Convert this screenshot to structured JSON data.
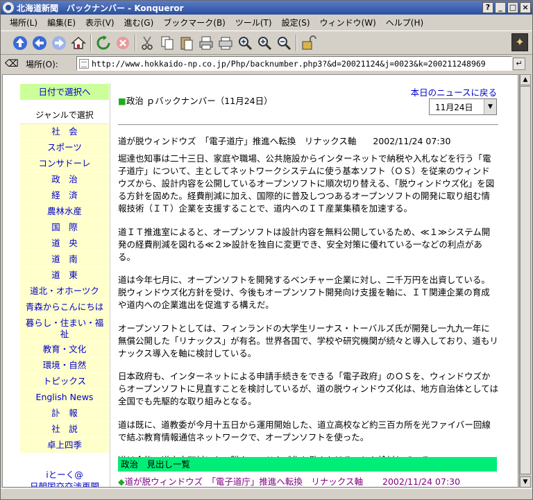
{
  "window": {
    "title": "北海道新聞　バックナンバー - Konqueror",
    "buttons": [
      "?",
      "_",
      "□",
      "×"
    ]
  },
  "menubar": {
    "items": [
      "場所(L)",
      "編集(E)",
      "表示(V)",
      "進む(G)",
      "ブックマーク(B)",
      "ツール(T)",
      "設定(S)",
      "ウィンドウ(W)",
      "ヘルプ(H)"
    ]
  },
  "toolbar": {
    "icons": [
      "up-icon",
      "back-icon",
      "forward-icon",
      "home-icon",
      "reload-icon",
      "stop-icon",
      "cut-icon",
      "copy-icon",
      "paste-icon",
      "print-icon",
      "print-frame-icon",
      "zoom-in-icon",
      "zoom-icon",
      "zoom-out-icon",
      "security-icon"
    ]
  },
  "location": {
    "label": "場所(O):",
    "url": "http://www.hokkaido-np.co.jp/Php/backnumber.php3?&d=20021124&j=0023&k=200211248969"
  },
  "nav": {
    "date_select": "日付で選択へ",
    "genre_label": "ジャンルで選択",
    "items": [
      "社　会",
      "スポーツ",
      "コンサドーレ",
      "政　治",
      "経　済",
      "農林水産",
      "国　際",
      "道　央",
      "道　南",
      "道　東",
      "道北・オホーツク",
      "青森からこんにちは",
      "暮らし・住まい・福祉",
      "教育・文化",
      "環境・自然",
      "トピックス",
      "English News",
      "訃　報",
      "社　説",
      "卓上四季"
    ],
    "bottom": [
      "iとーく@",
      "日朝国交交渉再開"
    ]
  },
  "main": {
    "crumb_prefix": "■",
    "crumb": "政治 ｐバックナンバー（11月24日）",
    "back_link": "本日のニュースに戻る",
    "date_value": "11月24日",
    "headline": "道が脱ウィンドウズ　「電子道庁」推進へ転換　リナックス軸",
    "headline_date": "2002/11/24 07:30",
    "paragraphs": [
      "堀達也知事は二十三日、家庭や職場、公共施設からインターネットで納税や入札などを行う「電子道庁」について、主としてネットワークシステムに使う基本ソフト（ＯＳ）を従来のウィンドウズから、設計内容を公開しているオープンソフトに順次切り替える、「脱ウィンドウズ化」を図る方針を固めた。経費削減に加え、国際的に普及しつつあるオープンソフトの開発に取り組む情報技術（ＩＴ）企業を支援することで、道内へのＩＴ産業集積を加速する。",
      "道ＩＴ推進室によると、オープンソフトは設計内容を無料公開しているため、≪１≫システム開発の経費削減を図れる≪２≫設計を独自に変更でき、安全対策に優れている一などの利点がある。",
      "道は今年七月に、オープンソフトを開発するベンチャー企業に対し、二千万円を出資している。脱ウィンドウズ化方針を受け、今後もオープンソフト開発向け支援を軸に、ＩＴ関連企業の育成や道内への企業進出を促進する構えだ。",
      "オープンソフトとしては、フィンランドの大学生リーナス・トーバルズ氏が開発し一九九一年に無償公開した「リナックス」が有名。世界各国で、学校や研究機関が続々と導入しており、道もリナックス導入を軸に検討している。",
      "日本政府も、インターネットによる申請手続きをできる「電子政府」のＯＳを、ウィンドウズからオープンソフトに見直すことを検討しているが、道の脱ウィンドウズ化は、地方自治体としては全国でも先駆的な取り組みとなる。",
      "道は既に、道教委が今月十五日から運用開始した、道立高校など約三百カ所を光ファイバー回線で結ぶ教育情報通信ネットワークで、オープンソフトを使った。",
      "道は今後、道内市町村にも、脱ウィンドウズ化を働きかけることも検討している。"
    ],
    "list_head": "政治　見出し一覧",
    "list_rows": [
      {
        "bullet": "◆",
        "title": "道が脱ウィンドウズ　「電子道庁」推進へ転換　リナックス軸",
        "date": "2002/11/24 07:30"
      }
    ]
  }
}
